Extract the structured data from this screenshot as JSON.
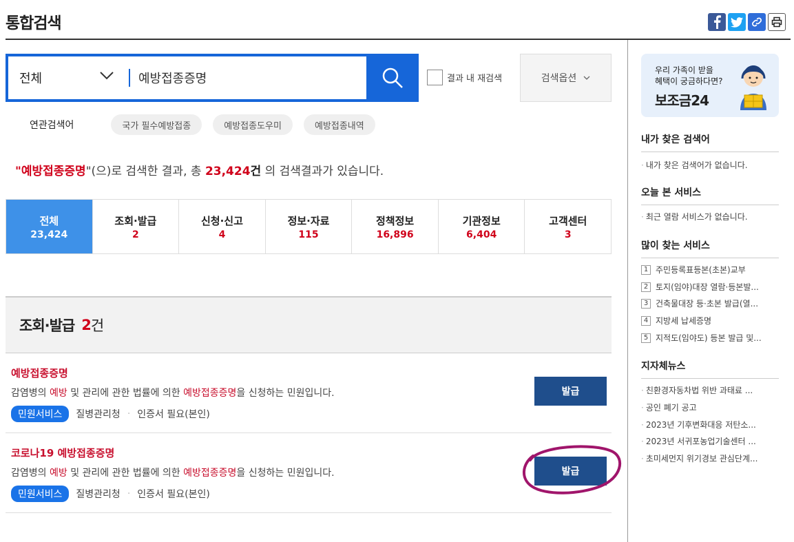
{
  "header": {
    "title": "통합검색"
  },
  "share": {
    "facebook_icon": "facebook-icon",
    "twitter_icon": "twitter-icon",
    "link_icon": "link-icon",
    "print_icon": "print-icon"
  },
  "search": {
    "scope": "전체",
    "query": "예방접종증명",
    "recheck_label": "결과 내 재검색",
    "options_label": "검색옵션"
  },
  "related": {
    "label": "연관검색어",
    "chips": [
      "국가 필수예방접종",
      "예방접종도우미",
      "예방접종내역"
    ]
  },
  "result_message": {
    "open_quote": "\"",
    "keyword": "예방접종증명",
    "mid": "\"(으)로 검색한 결과, 총 ",
    "total": "23,424",
    "unit": "건",
    "tail": " 의 검색결과가 있습니다."
  },
  "tabs": [
    {
      "label": "전체",
      "count": "23,424",
      "active": true
    },
    {
      "label": "조회·발급",
      "count": "2"
    },
    {
      "label": "신청·신고",
      "count": "4"
    },
    {
      "label": "정보·자료",
      "count": "115"
    },
    {
      "label": "정책정보",
      "count": "16,896"
    },
    {
      "label": "기관정보",
      "count": "6,404"
    },
    {
      "label": "고객센터",
      "count": "3"
    }
  ],
  "section": {
    "title": "조회·발급",
    "count": "2",
    "unit": "건"
  },
  "items": [
    {
      "title": "예방접종증명",
      "desc_parts": [
        "감염병의 ",
        "예방",
        " 및 관리에 관한 법률에 의한 ",
        "예방접종증명",
        "을 신청하는 민원입니다."
      ],
      "badge": "민원서비스",
      "org": "질병관리청",
      "cert": "인증서 필요(본인)",
      "button": "발급"
    },
    {
      "title": "코로나19 예방접종증명",
      "desc_parts": [
        "감염병의 ",
        "예방",
        " 및 관리에 관한 법률에 의한 ",
        "예방접종증명",
        "을 신청하는 민원입니다."
      ],
      "badge": "민원서비스",
      "org": "질병관리청",
      "cert": "인증서 필요(본인)",
      "button": "발급"
    }
  ],
  "sidebar": {
    "banner": {
      "line1": "우리 가족이 받을",
      "line2": "혜택이 궁금하다면?",
      "brand": "보조금24"
    },
    "my_keywords": {
      "title": "내가 찾은 검색어",
      "empty": "내가 찾은 검색어가 없습니다."
    },
    "today_services": {
      "title": "오늘 본 서비스",
      "empty": "최근 열람 서비스가 없습니다."
    },
    "popular": {
      "title": "많이 찾는 서비스",
      "items": [
        {
          "rank": "1",
          "label": "주민등록표등본(초본)교부"
        },
        {
          "rank": "2",
          "label": "토지(임야)대장 열람·등본발..."
        },
        {
          "rank": "3",
          "label": "건축물대장 등·초본 발급(열..."
        },
        {
          "rank": "4",
          "label": "지방세 납세증명"
        },
        {
          "rank": "5",
          "label": "지적도(임야도) 등본 발급 및..."
        }
      ]
    },
    "local_news": {
      "title": "지자체뉴스",
      "items": [
        "친환경자동차법 위반 과태료 ...",
        "공인 폐기 공고",
        "2023년 기후변화대응 저탄소...",
        "2023년 서귀포농업기술센터 ...",
        "초미세먼지 위기경보 관심단계..."
      ]
    }
  },
  "colors": {
    "primary": "#1666d9",
    "accent_red": "#d0021b",
    "issue_button": "#1f4e8c",
    "annotation": "#a0156b"
  }
}
